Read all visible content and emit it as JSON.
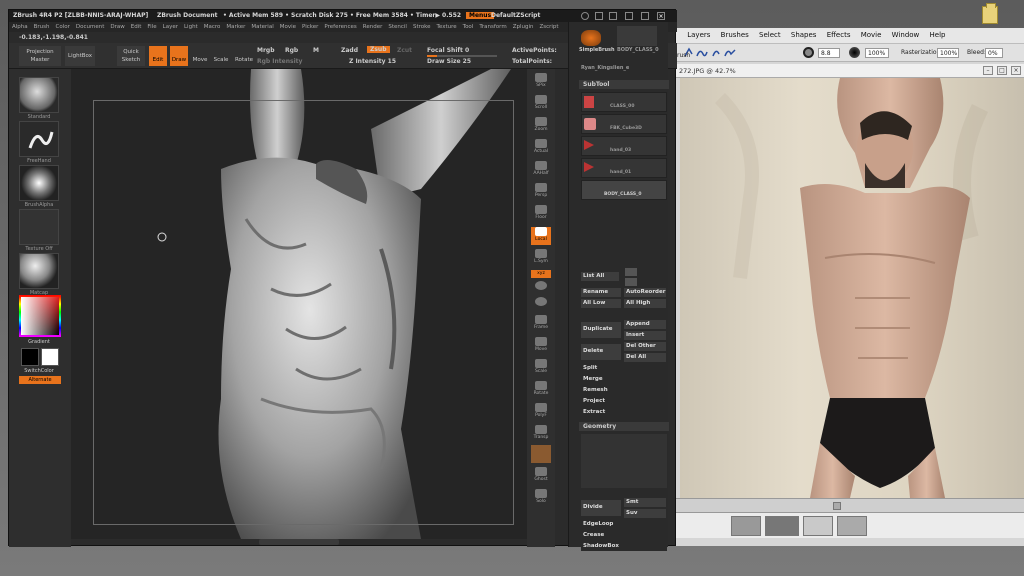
{
  "zbrush": {
    "title": "ZBrush 4R4 P2 [ZLBB-NNIS-ARAJ-WHAP]",
    "doc": "ZBrush Document",
    "mem": "• Active Mem 589 • Scratch Disk 275 • Free Mem 3584 • Timer▶ 0.552",
    "menus_btn": "Menus",
    "script": "DefaultZScript",
    "menu": [
      "Alpha",
      "Brush",
      "Color",
      "Document",
      "Draw",
      "Edit",
      "File",
      "Layer",
      "Light",
      "Macro",
      "Marker",
      "Material",
      "Movie",
      "Picker",
      "Preferences",
      "Render",
      "Stencil",
      "Stroke",
      "Texture",
      "Tool",
      "Transform",
      "Zplugin",
      "Zscript"
    ],
    "coords": "-0.183,-1.198,-0.841",
    "shelf": {
      "projection": "Projection\nMaster",
      "lightbox": "LightBox",
      "quicksketch": "Quick\nSketch",
      "edit": "Edit",
      "draw": "Draw",
      "move": "Move",
      "scale": "Scale",
      "rotate": "Rotate",
      "mrgb": "Mrgb",
      "rgb": "Rgb",
      "m": "M",
      "rgb_intensity": "Rgb Intensity",
      "zadd": "Zadd",
      "zsub": "Zsub",
      "zcut": "Zcut",
      "z_intensity": "Z Intensity 15",
      "focal_shift": "Focal Shift 0",
      "draw_size": "Draw Size 25",
      "active_points": "ActivePoints:",
      "total_points": "TotalPoints:"
    },
    "left_labels": [
      "Standard",
      "FreeHand",
      "BrushAlpha",
      "Texture Off",
      "Matcap",
      "Gradient",
      "SwitchColor",
      "Alternate"
    ],
    "right_tools": [
      "SPix",
      "Scroll",
      "Zoom",
      "Actual",
      "AAHalf",
      "Persp",
      "Floor",
      "Local",
      "L.Sym",
      "xyz",
      "",
      "",
      "Frame",
      "Move",
      "Scale",
      "Rotate",
      "PolyF",
      "Transp",
      "",
      "Ghost",
      "Solo"
    ],
    "tray": {
      "simple_brush": "SimpleBrush",
      "body_class": "BODY_CLASS_0",
      "ryan": "Ryan_Kingslien_e",
      "subtool": "SubTool",
      "subtools": [
        "CLASS_00",
        "FBK_Cube3D",
        "hand_03",
        "hand_01",
        "BODY_CLASS_0"
      ],
      "list_all": "List All",
      "rename": "Rename",
      "auto_reorder": "AutoReorder",
      "all_low": "All Low",
      "all_high": "All High",
      "duplicate": "Duplicate",
      "append": "Append",
      "insert": "Insert",
      "delete": "Delete",
      "del_other": "Del Other",
      "del_all": "Del All",
      "split": "Split",
      "merge": "Merge",
      "remesh": "Remesh",
      "project": "Project",
      "extract": "Extract",
      "geometry": "Geometry",
      "divide": "Divide",
      "smt": "Smt",
      "suv": "Suv",
      "edgeloop": "EdgeLoop",
      "crease": "Crease",
      "shadowbox": "ShadowBox"
    }
  },
  "photoshop": {
    "menu": [
      "Layers",
      "Brushes",
      "Select",
      "Shapes",
      "Effects",
      "Movie",
      "Window",
      "Help"
    ],
    "size": "8.8",
    "opacity": "100%",
    "rasterization_label": "Rasterization:",
    "rasterization": "100%",
    "bleed_label": "Bleed:",
    "bleed": "0%",
    "brush_text": "rush",
    "doc_title": "272.JPG @ 42.7%"
  }
}
